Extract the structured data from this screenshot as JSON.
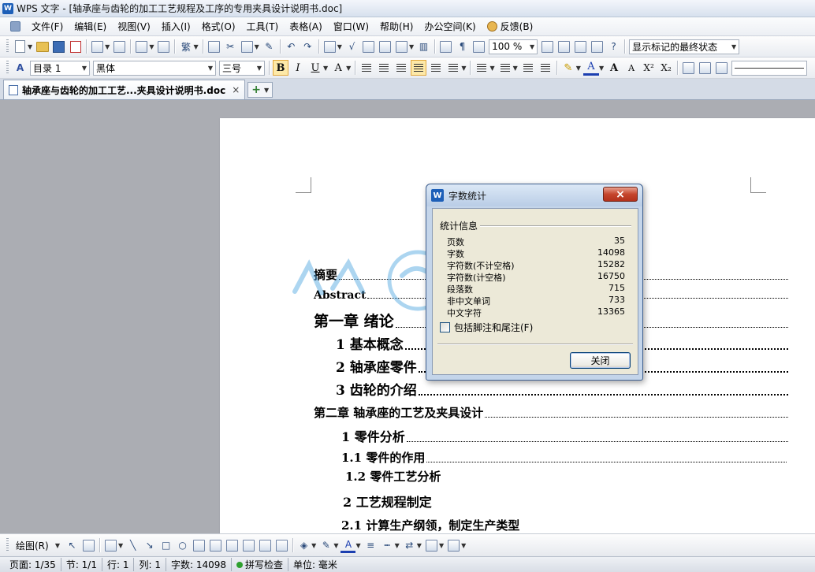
{
  "window": {
    "title": "WPS 文字 - [轴承座与齿轮的加工工艺规程及工序的专用夹具设计说明书.doc]"
  },
  "menu": [
    "文件(F)",
    "编辑(E)",
    "视图(V)",
    "插入(I)",
    "格式(O)",
    "工具(T)",
    "表格(A)",
    "窗口(W)",
    "帮助(H)",
    "办公空间(K)",
    "反馈(B)"
  ],
  "toolbar": {
    "zoom": "100 %",
    "markup_view": "显示标记的最终状态"
  },
  "format_bar": {
    "style": "目录 1",
    "font": "黑体",
    "size": "三号",
    "bold": "B",
    "italic": "I",
    "underline": "U"
  },
  "tab": {
    "label": "轴承座与齿轮的加工工艺...夹具设计说明书.doc",
    "close": "×",
    "new": "+"
  },
  "document": {
    "toc": [
      {
        "text": "摘要"
      },
      {
        "text": "Abstract"
      },
      {
        "text": "第一章  绪论"
      },
      {
        "text": "1  基本概念"
      },
      {
        "text": "2  轴承座零件"
      },
      {
        "text": "3  齿轮的介绍"
      },
      {
        "text": "第二章    轴承座的工艺及夹具设计"
      },
      {
        "text": "1  零件分析"
      },
      {
        "text": "1.1  零件的作用"
      },
      {
        "text": "1.2  零件工艺分析"
      },
      {
        "text": "2  工艺规程制定"
      },
      {
        "text": "2.1  计算生产纲领，制定生产类型"
      }
    ]
  },
  "dialog": {
    "title": "字数统计",
    "group": "统计信息",
    "stats": [
      {
        "label": "页数",
        "value": "35"
      },
      {
        "label": "字数",
        "value": "14098"
      },
      {
        "label": "字符数(不计空格)",
        "value": "15282"
      },
      {
        "label": "字符数(计空格)",
        "value": "16750"
      },
      {
        "label": "段落数",
        "value": "715"
      },
      {
        "label": "非中文单词",
        "value": "733"
      },
      {
        "label": "中文字符",
        "value": "13365"
      }
    ],
    "checkbox": "包括脚注和尾注(F)",
    "close_button": "关闭",
    "close_icon": "×"
  },
  "drawbar": {
    "label": "绘图(R)"
  },
  "status": {
    "page": "页面: 1/35",
    "section": "节: 1/1",
    "row": "行: 1",
    "col": "列: 1",
    "words": "字数: 14098",
    "spell": "拼写检查",
    "unit": "单位: 毫米"
  }
}
